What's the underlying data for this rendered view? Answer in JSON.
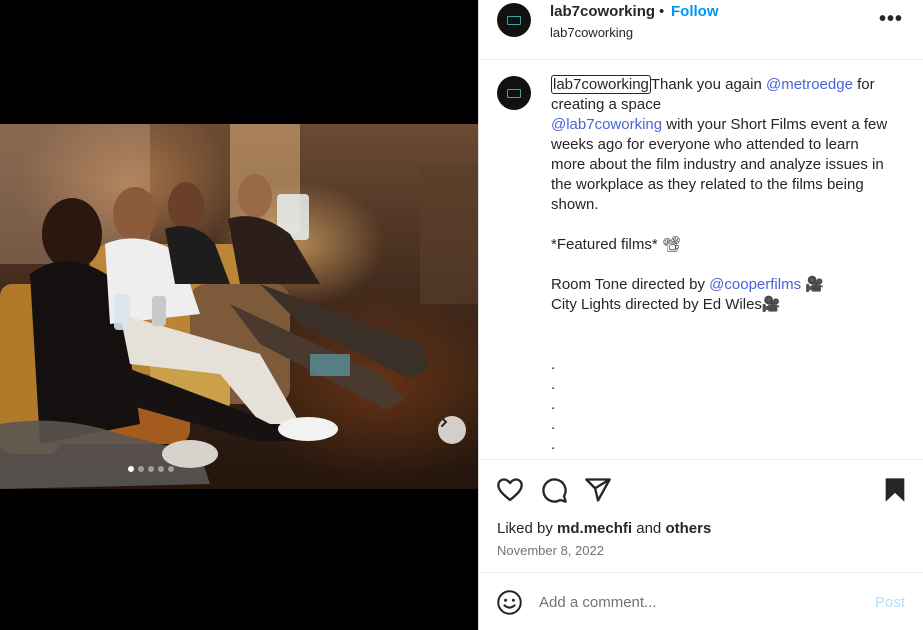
{
  "post": {
    "username": "lab7coworking",
    "separator": "•",
    "follow_label": "Follow",
    "subtitle": "lab7coworking",
    "more_label": "•••"
  },
  "caption": {
    "username": "lab7coworking",
    "line1_text": "Thank you again ",
    "mention1": "@metroedge",
    "line1_tail": " for creating a space",
    "mention2": "@lab7coworking",
    "line2_text": " with your Short Films event a few weeks ago for everyone who attended to learn more about the film industry and analyze issues in the workplace as they related to the films being shown.",
    "featured": "*Featured films* 📽",
    "film1_prefix": "Room Tone directed by ",
    "film1_mention": "@cooperfilms",
    "film1_suffix": " 🎥",
    "film2": "City Lights directed by Ed Wiles🎥",
    "dots": [
      ".",
      ".",
      ".",
      ".",
      "."
    ]
  },
  "actions": {
    "icons": [
      "heart-icon",
      "comment-icon",
      "share-icon",
      "bookmark-icon"
    ]
  },
  "likes": {
    "prefix": "Liked by ",
    "user": "md.mechfi",
    "and": " and ",
    "others": "others"
  },
  "date": "November 8, 2022",
  "comment": {
    "placeholder": "Add a comment...",
    "post_label": "Post"
  },
  "carousel": {
    "slide_count": 5,
    "active_index": 0
  },
  "colors": {
    "accent": "#0095f6",
    "mention": "#4a63d9",
    "post_disabled": "#b2dffc"
  }
}
